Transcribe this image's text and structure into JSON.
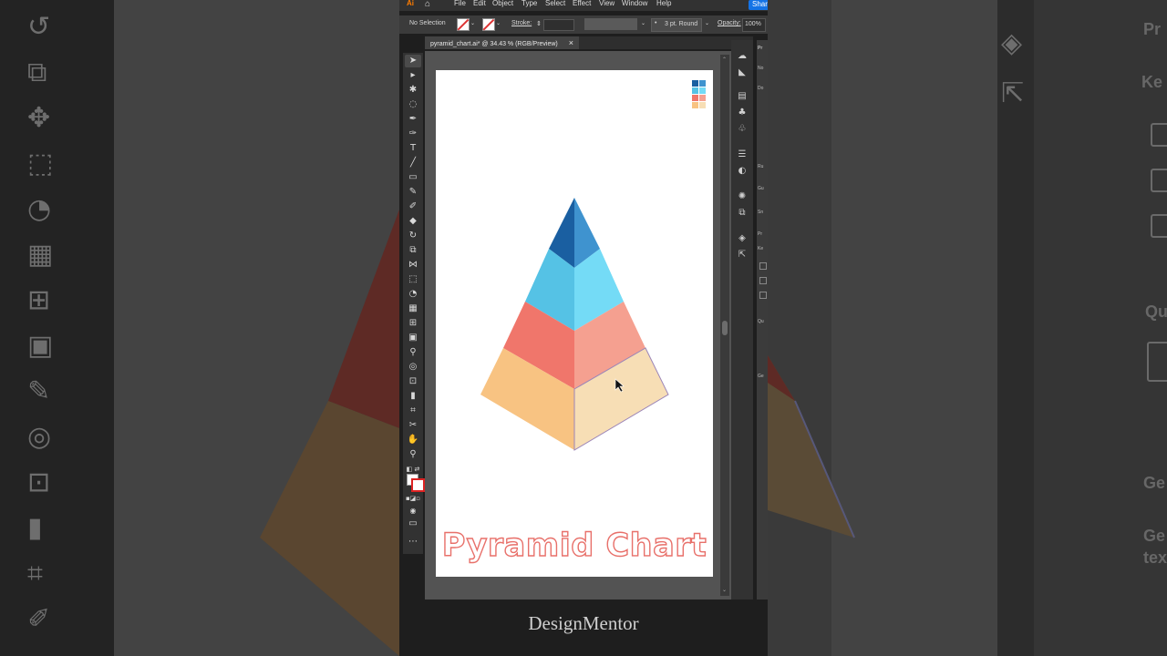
{
  "app": {
    "logo": "Ai",
    "menu": [
      "File",
      "Edit",
      "Object",
      "Type",
      "Select",
      "Effect",
      "View",
      "Window",
      "Help"
    ],
    "share_label": "Share"
  },
  "control_bar": {
    "selection": "No Selection",
    "stroke_label": "Stroke:",
    "brush": "3 pt. Round",
    "opacity_label": "Opacity:",
    "opacity_value": "100%"
  },
  "document": {
    "tab_title": "pyramid_chart.ai* @ 34.43 % (RGB/Preview)",
    "close_icon": "×"
  },
  "artboard": {
    "chart_title": "Pyramid Chart",
    "palette": {
      "dark_blue": "#1a5fa1",
      "blue_light_face": "#3f93cf",
      "cyan_left": "#55c2e5",
      "cyan_right": "#74dbf6",
      "red_left": "#f0766b",
      "red_right": "#f5a090",
      "orange_left": "#f8c382",
      "orange_right": "#f7deb5"
    },
    "legend_colors": [
      "#1a5fa1",
      "#3f93cf",
      "#55c2e5",
      "#74dbf6",
      "#f0766b",
      "#f5a090",
      "#f8c382",
      "#f7deb5"
    ]
  },
  "properties_panel": {
    "labels": [
      "Pr",
      "No",
      "Do",
      "Ru",
      "Gu",
      "Sn",
      "Pr",
      "Ke",
      "Qu",
      "Ge"
    ]
  },
  "watermark": "DesignMentor",
  "background": {
    "left_labels": [],
    "right_labels": [
      "Pr",
      "Ke",
      "Qu",
      "Ge",
      "Ge",
      "tex"
    ]
  }
}
